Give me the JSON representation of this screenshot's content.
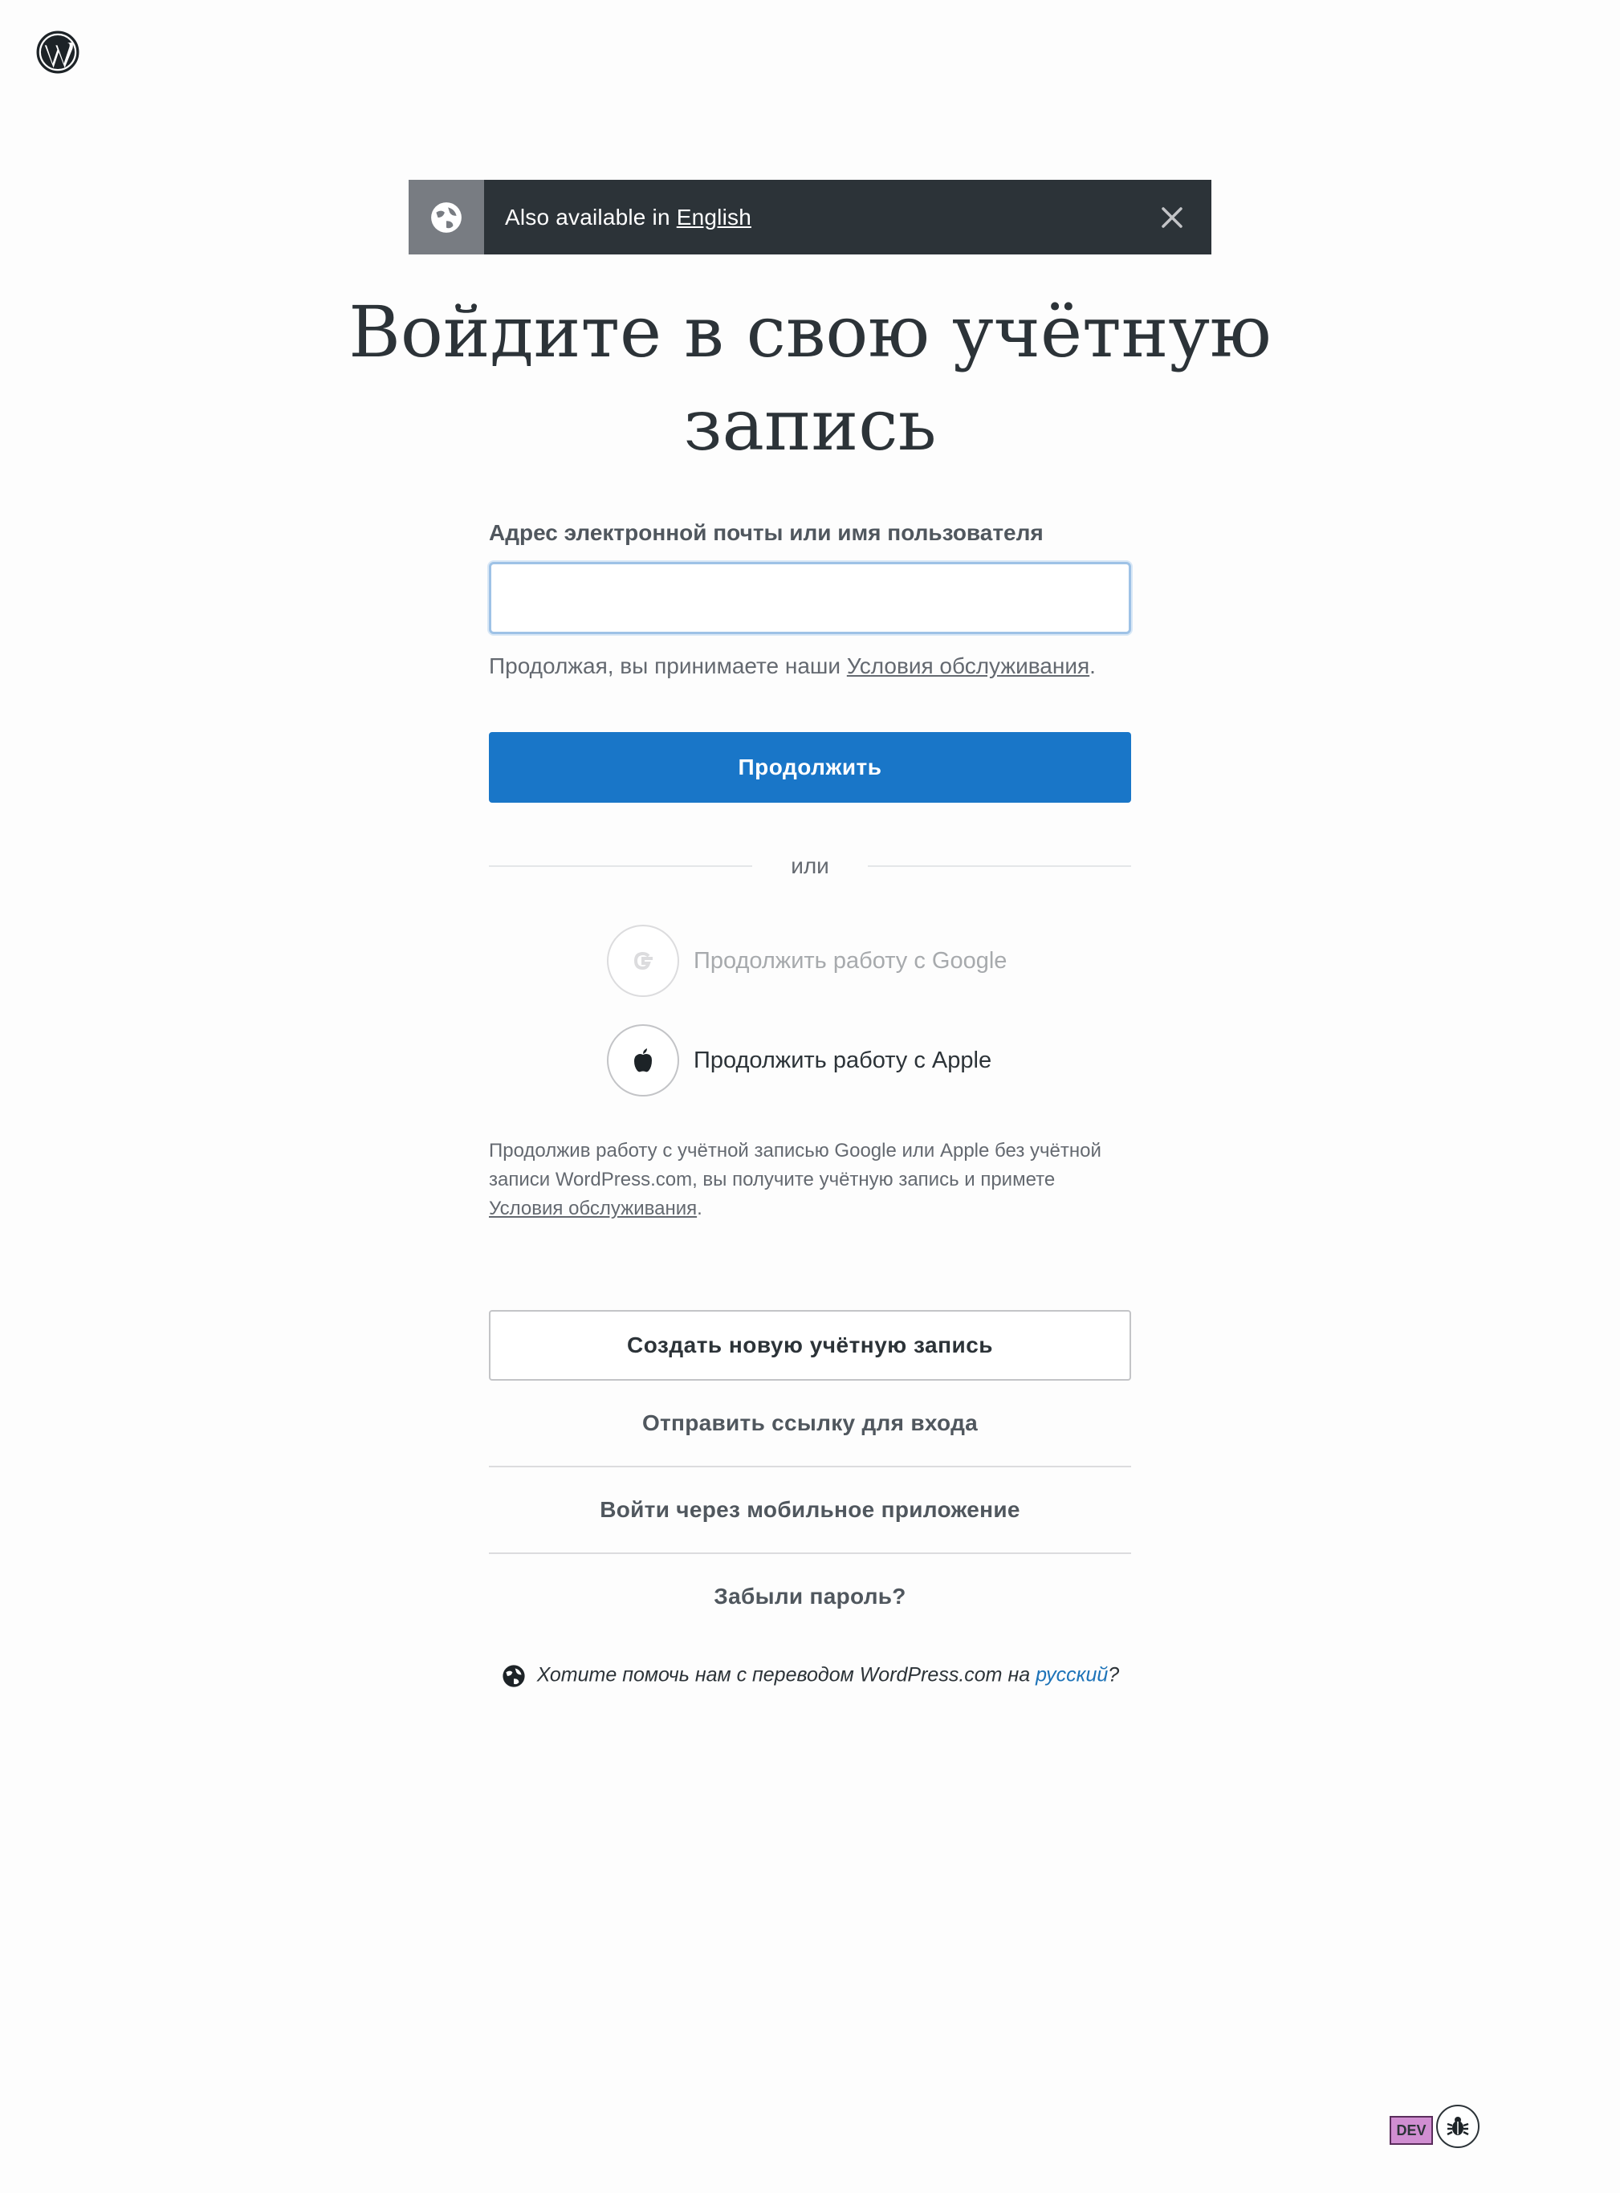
{
  "header": {
    "logo_icon": "wordpress-logo-icon"
  },
  "notice": {
    "icon": "globe-icon",
    "prefix": "Also available in",
    "link": "English",
    "close_icon": "close-icon"
  },
  "title_line1": "Войдите в свою учётную",
  "title_line2": "запись",
  "form": {
    "field_label": "Адрес электронной почты или имя пользователя",
    "field_value": "",
    "tos_prefix": "Продолжая, вы принимаете наши",
    "tos_link": "Условия обслуживания",
    "tos_suffix": ".",
    "continue_label": "Продолжить"
  },
  "divider": {
    "or": "или"
  },
  "social": {
    "google_label": "Продолжить работу с Google",
    "google_icon": "google-icon",
    "apple_label": "Продолжить работу с Apple",
    "apple_icon": "apple-icon",
    "note_text": "Продолжив работу с учётной записью Google или Apple без учётной записи WordPress.com, вы получите учётную запись и примете",
    "note_link": "Условия обслуживания",
    "note_suffix": "."
  },
  "actions": {
    "create_account": "Создать новую учётную запись",
    "send_link": "Отправить ссылку для входа",
    "mobile_app": "Войти через мобильное приложение",
    "forgot_password": "Забыли пароль?"
  },
  "translate": {
    "icon": "globe-icon",
    "text": "Хотите помочь нам с переводом WordPress.com на",
    "link": "русский",
    "suffix": "?"
  },
  "dev": {
    "badge": "DEV",
    "bug_icon": "bug-icon"
  },
  "colors": {
    "primary": "#1976c8",
    "notice_bg": "#2c3338",
    "notice_icon_bg": "#787c82"
  }
}
